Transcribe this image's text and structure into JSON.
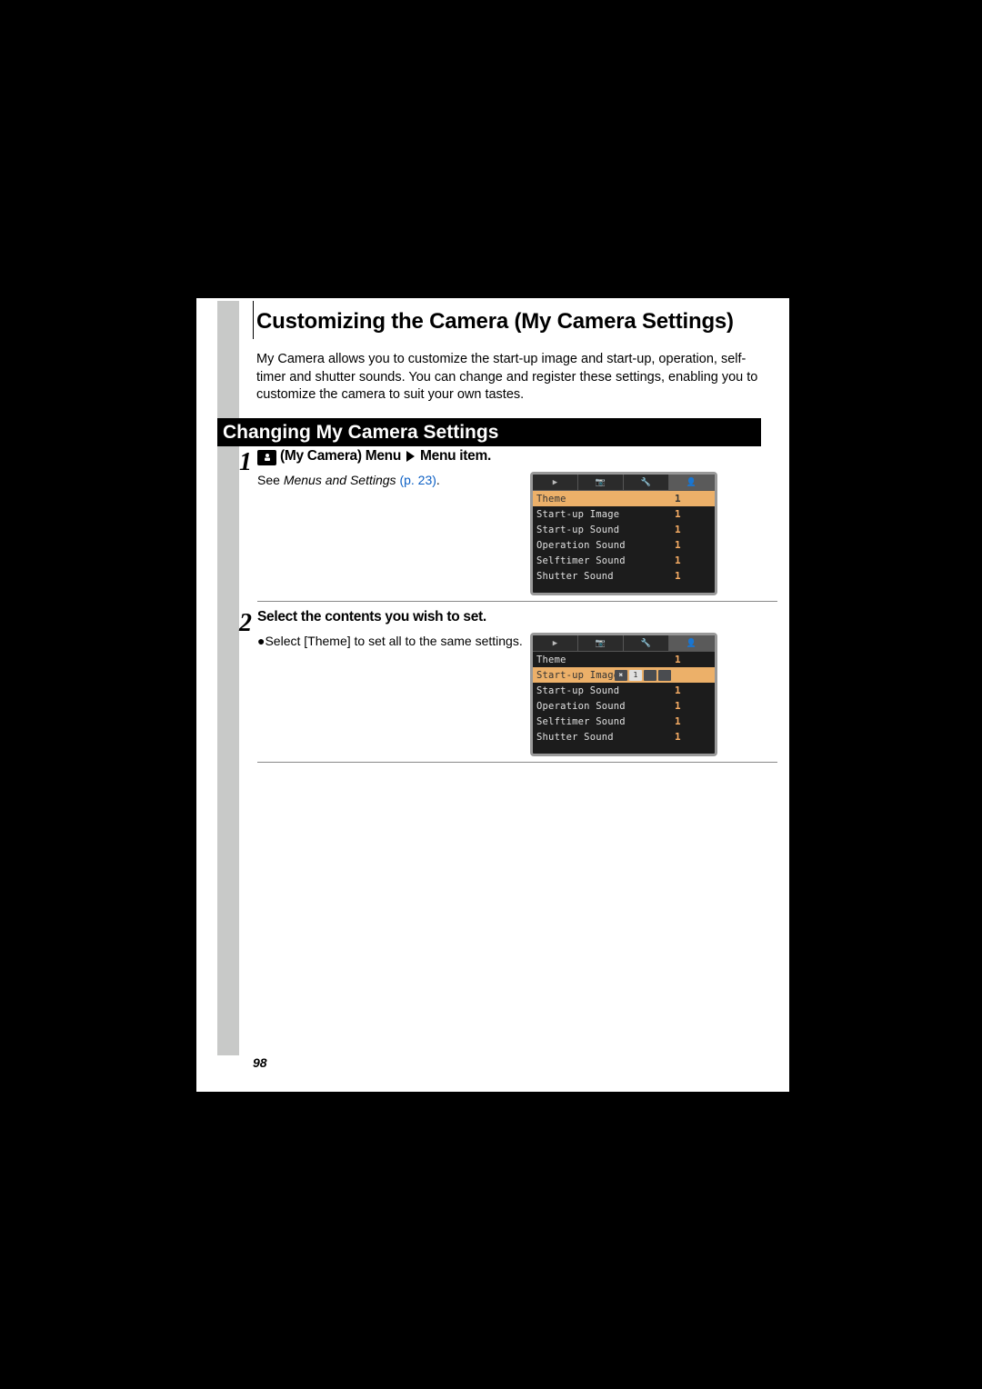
{
  "page_number": "98",
  "chapter_title": "Customizing the Camera (My Camera Settings)",
  "intro_text": "My Camera allows you to customize the start-up image and start-up, operation, self-timer and shutter sounds. You can change and register these settings, enabling you to customize the camera to suit your own tastes.",
  "section_heading": "Changing My Camera Settings",
  "steps": [
    {
      "num": "1",
      "heading_prefix": "(My Camera) Menu",
      "heading_suffix": "Menu item.",
      "see_text": "See ",
      "see_italic": "Menus and Settings",
      "see_page": "(p. 23)",
      "lcd_active_tab": 3,
      "lcd_rows": [
        {
          "label": "Theme",
          "val": "1",
          "sel": true
        },
        {
          "label": "Start-up Image",
          "val": "1"
        },
        {
          "label": "Start-up Sound",
          "val": "1"
        },
        {
          "label": "Operation Sound",
          "val": "1"
        },
        {
          "label": "Selftimer Sound",
          "val": "1"
        },
        {
          "label": "Shutter Sound",
          "val": "1"
        }
      ]
    },
    {
      "num": "2",
      "heading_full": "Select the contents you wish to set.",
      "bullet_text": "Select [Theme] to set all to the same settings.",
      "lcd_active_tab": 3,
      "lcd_rows": [
        {
          "label": "Theme",
          "val": "1"
        },
        {
          "label": "Start-up Image",
          "sel": true,
          "thumbs": true
        },
        {
          "label": "Start-up Sound",
          "val": "1"
        },
        {
          "label": "Operation Sound",
          "val": "1"
        },
        {
          "label": "Selftimer Sound",
          "val": "1"
        },
        {
          "label": "Shutter Sound",
          "val": "1"
        }
      ]
    }
  ],
  "lcd_tab_glyphs": [
    "▶",
    "📷",
    "🔧",
    "👤"
  ]
}
